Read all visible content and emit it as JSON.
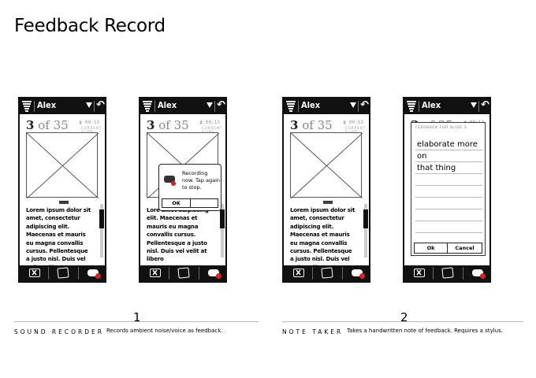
{
  "page": {
    "title": "Feedback Record"
  },
  "phone": {
    "user": "Alex",
    "slide_current": "3",
    "slide_of": "of 35",
    "timer": "00:13",
    "slide_label": "CURRENT SLIDE",
    "notes": "Lorem ipsum dolor sit amet, consectetur adipiscing elit. Maecenas et mauris eu magna convallis cursus. Pellentesque a justo nisl. Duis vel velit at libero",
    "notes_short": "Lore amet adipiscing elit. Maecenas et mauris eu magna convallis cursus. Pellentesque a justo nisl. Duis vel velit at libero"
  },
  "recording_popup": {
    "message": "Recording now. Tap again to stop.",
    "ok_label": "OK"
  },
  "note_taker_panel": {
    "label": "FEEDBACK FOR SLIDE 3",
    "text_line1": "elaborate more on",
    "text_line2": "that thing",
    "ok_label": "Ok",
    "cancel_label": "Cancel"
  },
  "sections": [
    {
      "number": "1",
      "label": "SOUND RECORDER",
      "description": "Records ambient noise/voice as feedback."
    },
    {
      "number": "2",
      "label": "NOTE TAKER",
      "description": "Takes a handwritten note of feedback. Requires a stylus."
    }
  ],
  "colors": {
    "bar": "#111111",
    "record_dot": "#e0201d"
  }
}
